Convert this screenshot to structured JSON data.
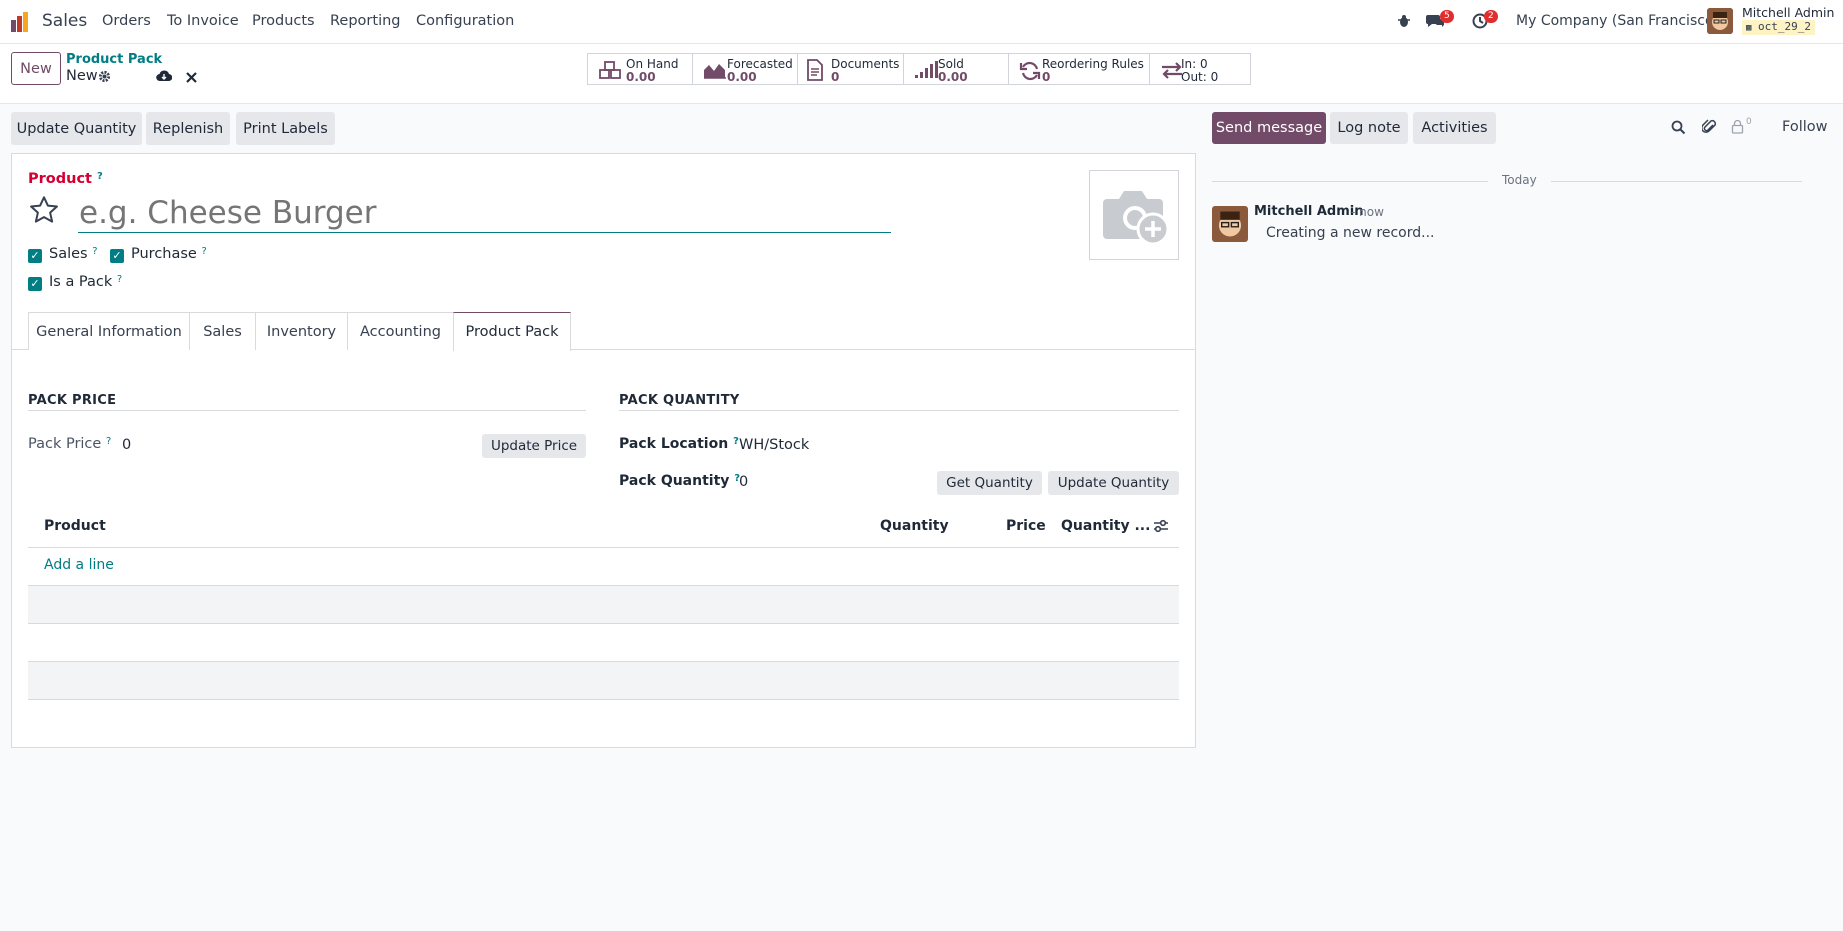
{
  "navbar": {
    "app_name": "Sales",
    "menu": [
      "Orders",
      "To Invoice",
      "Products",
      "Reporting",
      "Configuration"
    ],
    "messages_count": "5",
    "activities_count": "2",
    "company": "My Company (San Francisco)",
    "user_name": "Mitchell Admin",
    "db_name": "oct_29_2"
  },
  "control": {
    "new_label": "New",
    "breadcrumb_parent": "Product Pack",
    "breadcrumb_current": "New"
  },
  "stats": [
    {
      "label": "On Hand",
      "value": "0.00",
      "icon": "cubes-icon"
    },
    {
      "label": "Forecasted",
      "value": "0.00",
      "icon": "area-chart-icon"
    },
    {
      "label": "Documents",
      "value": "0",
      "icon": "document-icon"
    },
    {
      "label": "Sold",
      "value": "0.00",
      "icon": "signal-icon"
    },
    {
      "label": "Reordering Rules",
      "value": "0",
      "icon": "refresh-icon"
    },
    {
      "label": "In: 0",
      "value": "Out: 0",
      "icon": "exchange-icon"
    }
  ],
  "actions": {
    "update_quantity": "Update Quantity",
    "replenish": "Replenish",
    "print_labels": "Print Labels"
  },
  "form": {
    "product_label": "Product",
    "name_placeholder": "e.g. Cheese Burger",
    "sales_label": "Sales",
    "purchase_label": "Purchase",
    "is_pack_label": "Is a Pack",
    "tabs": [
      "General Information",
      "Sales",
      "Inventory",
      "Accounting",
      "Product Pack"
    ],
    "active_tab": "Product Pack",
    "pack_price_title": "PACK PRICE",
    "pack_price_label": "Pack Price",
    "pack_price_value": "0",
    "update_price_label": "Update Price",
    "pack_quantity_title": "PACK QUANTITY",
    "pack_location_label": "Pack Location",
    "pack_location_value": "WH/Stock",
    "pack_quantity_label": "Pack Quantity",
    "pack_quantity_value": "0",
    "get_quantity_label": "Get Quantity",
    "update_quantity_label": "Update Quantity",
    "table_headers": [
      "Product",
      "Quantity",
      "Price",
      "Quantity ..."
    ],
    "add_line": "Add a line"
  },
  "chatter": {
    "send_message": "Send message",
    "log_note": "Log note",
    "activities": "Activities",
    "followers_count": "0",
    "follow": "Follow",
    "date_separator": "Today",
    "message_author": "Mitchell Admin",
    "message_time": "- now",
    "message_body": "Creating a new record..."
  },
  "colors": {
    "brand": "#714b67",
    "accent": "#017e84",
    "required": "#d40032"
  }
}
